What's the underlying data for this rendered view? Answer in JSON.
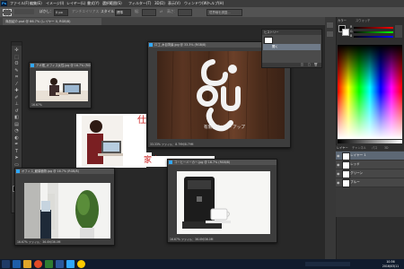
{
  "app": {
    "logo_text": "Ps",
    "menu": [
      "ファイル(F)",
      "編集(E)",
      "イメージ(I)",
      "レイヤー(L)",
      "書式(Y)",
      "選択範囲(S)",
      "フィルター(T)",
      "3D(D)",
      "表示(V)",
      "ウィンドウ(W)",
      "ヘルプ(H)"
    ]
  },
  "options_bar": {
    "feather_label": "ぼかし：",
    "feather_value": "0 px",
    "antialias_label": "アンチエイリアス",
    "style_label": "スタイル：",
    "style_value": "標準",
    "width_label": "幅：",
    "height_label": "高さ：",
    "refine_edge_label": "境界線を調整..."
  },
  "document_tab": {
    "label": "商品紹介.psd @ 66.7% (レイヤー 0, RGB/8)"
  },
  "tools": [
    {
      "name": "move-tool-icon",
      "glyph": "✣"
    },
    {
      "name": "marquee-tool-icon",
      "glyph": "⬚"
    },
    {
      "name": "lasso-tool-icon",
      "glyph": "ʘ"
    },
    {
      "name": "quick-select-tool-icon",
      "glyph": "✎"
    },
    {
      "name": "crop-tool-icon",
      "glyph": "⌗"
    },
    {
      "name": "eyedropper-tool-icon",
      "glyph": "⁄"
    },
    {
      "name": "healing-tool-icon",
      "glyph": "✚"
    },
    {
      "name": "brush-tool-icon",
      "glyph": "✐"
    },
    {
      "name": "clone-stamp-tool-icon",
      "glyph": "⊥"
    },
    {
      "name": "history-brush-tool-icon",
      "glyph": "↺"
    },
    {
      "name": "eraser-tool-icon",
      "glyph": "◧"
    },
    {
      "name": "gradient-tool-icon",
      "glyph": "▤"
    },
    {
      "name": "blur-tool-icon",
      "glyph": "◔"
    },
    {
      "name": "dodge-tool-icon",
      "glyph": "◐"
    },
    {
      "name": "pen-tool-icon",
      "glyph": "✒"
    },
    {
      "name": "type-tool-icon",
      "glyph": "T"
    },
    {
      "name": "path-select-tool-icon",
      "glyph": "➤"
    },
    {
      "name": "shape-tool-icon",
      "glyph": "▭"
    },
    {
      "name": "hand-tool-icon",
      "glyph": "✋"
    },
    {
      "name": "zoom-tool-icon",
      "glyph": "⌕"
    }
  ],
  "documents": {
    "woman_pc": {
      "title": "アオ鐙_オフィス女性.jpg @ 16.7% (RGB/8)",
      "status": "16.67%"
    },
    "logo_wood": {
      "title": "ロゴ_木目背景.jpg @ 33.3% (RGB/8)",
      "status": "33.33%  ファイル：8.79M/8.79M",
      "brand": "有限会社ジー・アップ"
    },
    "office": {
      "title": "オフィス_観葉植物.jpg @ 16.7% (RGB/8)",
      "status": "16.67%  ファイル：36.0M/36.0M"
    },
    "coffee": {
      "title": "コーヒーメーカー.jpg @ 16.7% (RGB/8)",
      "status": "16.67%  ファイル：36.0M/36.0M"
    },
    "flyer": {
      "text_top": "仕",
      "text_bottom": "家事"
    }
  },
  "history_panel": {
    "tab_label": "ヒストリー",
    "item_label": "開く"
  },
  "right_panels": {
    "color_tab": "カラー",
    "swatches_tab": "スウォッチ",
    "channels": [
      "R",
      "G",
      "B"
    ],
    "layers_tabs": [
      "レイヤー",
      "チャンネル",
      "パス",
      "3D"
    ],
    "layers": [
      {
        "label": "レイヤー 1"
      },
      {
        "label": "レッド"
      },
      {
        "label": "グリーン"
      },
      {
        "label": "ブルー"
      }
    ]
  },
  "taskbar": {
    "time": "10:36",
    "date": "2016/03/11"
  },
  "colors": {
    "accent": "#31a8ff",
    "panel": "#535353",
    "workspace": "#282828",
    "flyer_red": "#cc2222"
  }
}
